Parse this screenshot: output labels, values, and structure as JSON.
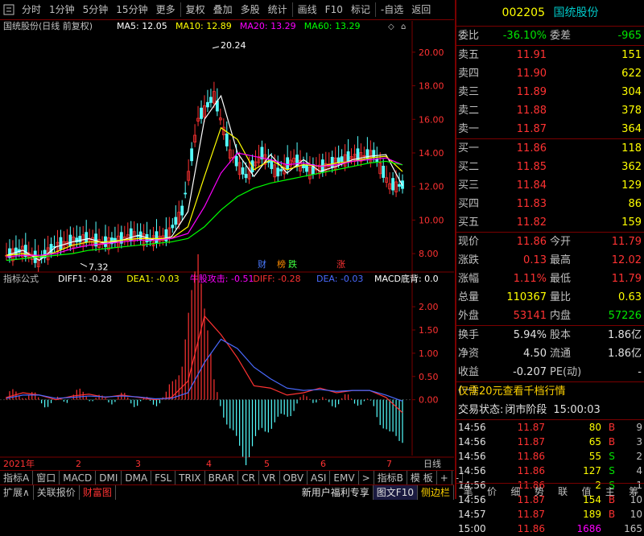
{
  "toolbar": {
    "buttons": [
      "分时",
      "1分钟",
      "5分钟",
      "15分钟",
      "更多",
      "复权",
      "叠加",
      "多股",
      "统计",
      "画线",
      "F10",
      "标记",
      "-自选",
      "返回"
    ],
    "more_arrow": "▸"
  },
  "chart": {
    "title": "国统股份(日线 前复权)",
    "ma5": "MA5: 12.05",
    "ma10": "MA10: 12.89",
    "ma20": "MA20: 13.29",
    "ma60": "MA60: 13.29",
    "high_label": "20.24",
    "low_label": "7.32",
    "y_ticks": [
      "20.00",
      "18.00",
      "16.00",
      "14.00",
      "12.00",
      "10.00",
      "8.00"
    ],
    "markers": [
      {
        "text": "财",
        "color": "#4a7aff"
      },
      {
        "text": "榜",
        "color": "#ff8c00"
      },
      {
        "text": "跌",
        "color": "#40ff40"
      },
      {
        "text": "涨",
        "color": "#ff3232"
      }
    ],
    "colors": {
      "ma5": "#ffffff",
      "ma10": "#ffff00",
      "ma20": "#ff00ff",
      "ma60": "#00ff00",
      "up": "#ff3232",
      "down": "#54ffff"
    },
    "chart_data": {
      "type": "line",
      "title": "国统股份(日线 前复权)",
      "ylim": [
        7,
        21
      ],
      "high": 20.24,
      "low": 7.32,
      "series": [
        {
          "name": "MA5",
          "values": [
            7.9,
            8.2,
            7.6,
            8.4,
            8.7,
            8.9,
            8.6,
            8.8,
            9.1,
            8.8,
            9.0,
            10.5,
            16.0,
            17.4,
            14.0,
            12.6,
            13.9,
            12.8,
            13.6,
            12.9,
            13.2,
            13.6,
            13.8,
            13.9,
            12.05
          ]
        },
        {
          "name": "MA10",
          "values": [
            7.9,
            8.0,
            7.8,
            8.1,
            8.5,
            8.7,
            8.7,
            8.8,
            8.9,
            8.9,
            8.9,
            9.6,
            12.6,
            15.5,
            14.8,
            13.0,
            13.6,
            13.0,
            13.3,
            13.2,
            13.4,
            13.5,
            13.7,
            13.8,
            12.89
          ]
        },
        {
          "name": "MA20",
          "values": [
            7.8,
            7.9,
            7.9,
            8.0,
            8.3,
            8.5,
            8.6,
            8.7,
            8.8,
            8.8,
            8.9,
            9.2,
            10.8,
            12.8,
            14.0,
            13.8,
            13.6,
            13.3,
            13.4,
            13.2,
            13.3,
            13.5,
            13.6,
            13.7,
            13.29
          ]
        },
        {
          "name": "MA60",
          "values": [
            7.6,
            7.7,
            7.8,
            7.9,
            8.0,
            8.2,
            8.3,
            8.4,
            8.5,
            8.6,
            8.7,
            8.9,
            9.6,
            10.6,
            11.4,
            11.9,
            12.2,
            12.4,
            12.6,
            12.8,
            13.0,
            13.2,
            13.4,
            13.5,
            13.29
          ]
        }
      ]
    }
  },
  "indicator": {
    "title": "指标公式",
    "diff1": "DIFF1: -0.28",
    "dea1": "DEA1: -0.03",
    "niu": "牛股攻击: -0.51",
    "diff": "DIFF: -0.28",
    "dea": "DEA: -0.03",
    "macd": "MACD底背: 0.0",
    "y_ticks": [
      "2.00",
      "1.50",
      "1.00",
      "0.50",
      "0.00"
    ],
    "chart_data": {
      "type": "bar",
      "ylim": [
        -1.2,
        2.4
      ],
      "diff": [
        0.05,
        0.15,
        0.1,
        0.0,
        0.08,
        0.12,
        0.05,
        0.1,
        0.05,
        0.0,
        0.05,
        0.4,
        1.8,
        1.4,
        0.9,
        0.3,
        0.25,
        0.1,
        0.15,
        0.25,
        0.15,
        0.2,
        0.2,
        0.05,
        -0.28
      ],
      "dea": [
        0.03,
        0.1,
        0.1,
        0.03,
        0.05,
        0.08,
        0.06,
        0.08,
        0.06,
        0.02,
        0.03,
        0.15,
        0.8,
        1.3,
        1.1,
        0.7,
        0.45,
        0.25,
        0.2,
        0.22,
        0.18,
        0.2,
        0.2,
        0.1,
        -0.03
      ]
    }
  },
  "x_axis": [
    "2021年",
    "2",
    "3",
    "4",
    "5",
    "6",
    "7"
  ],
  "x_axis_right": "日线",
  "bottom_tabs": [
    "指标A",
    "窗口",
    "MACD",
    "DMI",
    "DMA",
    "FSL",
    "TRIX",
    "BRAR",
    "CR",
    "VR",
    "OBV",
    "ASI",
    "EMV",
    ">",
    "指标B",
    "模 板",
    "+",
    "-"
  ],
  "status": {
    "expand": "扩展∧",
    "related": "关联报价",
    "caifu": "财富图",
    "promo": "新用户福利专享",
    "f10": "图文F10",
    "sidebar": "侧边栏"
  },
  "quote": {
    "code": "002205",
    "name": "国统股份",
    "weibi_label": "委比",
    "weibi": "-36.10%",
    "weicha_label": "委差",
    "weicha": "-965",
    "sell": [
      {
        "label": "卖五",
        "price": "11.91",
        "vol": "151"
      },
      {
        "label": "卖四",
        "price": "11.90",
        "vol": "622"
      },
      {
        "label": "卖三",
        "price": "11.89",
        "vol": "304"
      },
      {
        "label": "卖二",
        "price": "11.88",
        "vol": "378"
      },
      {
        "label": "卖一",
        "price": "11.87",
        "vol": "364"
      }
    ],
    "buy": [
      {
        "label": "买一",
        "price": "11.86",
        "vol": "118"
      },
      {
        "label": "买二",
        "price": "11.85",
        "vol": "362"
      },
      {
        "label": "买三",
        "price": "11.84",
        "vol": "129"
      },
      {
        "label": "买四",
        "price": "11.83",
        "vol": "86"
      },
      {
        "label": "买五",
        "price": "11.82",
        "vol": "159"
      }
    ],
    "stats": [
      {
        "l1": "现价",
        "v1": "11.86",
        "c1": "red",
        "l2": "今开",
        "v2": "11.79",
        "c2": "red"
      },
      {
        "l1": "涨跌",
        "v1": "0.13",
        "c1": "red",
        "l2": "最高",
        "v2": "12.02",
        "c2": "red"
      },
      {
        "l1": "涨幅",
        "v1": "1.11%",
        "c1": "red",
        "l2": "最低",
        "v2": "11.79",
        "c2": "red"
      },
      {
        "l1": "总量",
        "v1": "110367",
        "c1": "yellow",
        "l2": "量比",
        "v2": "0.63",
        "c2": "yellow"
      },
      {
        "l1": "外盘",
        "v1": "53141",
        "c1": "red",
        "l2": "内盘",
        "v2": "57226",
        "c2": "green"
      }
    ],
    "stats2": [
      {
        "l1": "换手",
        "v1": "5.94%",
        "c1": "white",
        "l2": "股本",
        "v2": "1.86亿",
        "c2": "white"
      },
      {
        "l1": "净资",
        "v1": "4.50",
        "c1": "white",
        "l2": "流通",
        "v2": "1.86亿",
        "c2": "white"
      },
      {
        "l1": "收益(一)",
        "v1": "-0.207",
        "c1": "white",
        "l2": "PE(动)",
        "v2": "-",
        "c2": "white"
      }
    ],
    "promo": "仅需20元查看千档行情",
    "state_label": "交易状态:",
    "state": "闭市阶段",
    "state_time": "15:00:03",
    "ticks": [
      {
        "t": "14:56",
        "p": "11.87",
        "v": "80",
        "d": "B",
        "n": "9"
      },
      {
        "t": "14:56",
        "p": "11.87",
        "v": "65",
        "d": "B",
        "n": "3"
      },
      {
        "t": "14:56",
        "p": "11.86",
        "v": "55",
        "d": "S",
        "n": "2"
      },
      {
        "t": "14:56",
        "p": "11.86",
        "v": "127",
        "d": "S",
        "n": "4"
      },
      {
        "t": "14:56",
        "p": "11.86",
        "v": "2",
        "d": "S",
        "n": "1"
      },
      {
        "t": "14:56",
        "p": "11.87",
        "v": "154",
        "d": "B",
        "n": "10"
      },
      {
        "t": "14:57",
        "p": "11.87",
        "v": "189",
        "d": "B",
        "n": "10"
      },
      {
        "t": "15:00",
        "p": "11.86",
        "v": "1686",
        "d": "",
        "n": "165"
      }
    ],
    "nav": [
      "笔",
      "价",
      "细",
      "势",
      "联",
      "值",
      "主",
      "筹"
    ]
  }
}
